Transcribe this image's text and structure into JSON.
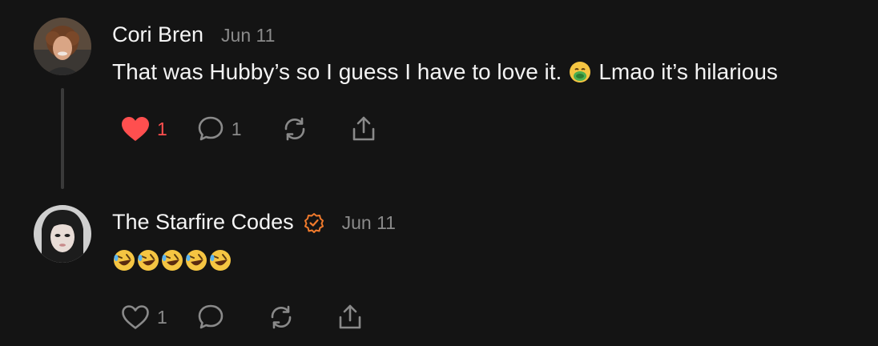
{
  "posts": [
    {
      "author": "Cori Bren",
      "date": "Jun 11",
      "text_before": "That was Hubby’s so I guess I have to love it.",
      "emoji": "nauseated-face",
      "text_after": "Lmao it’s hilarious",
      "like_count": "1",
      "liked": true,
      "reply_count": "1"
    },
    {
      "author": "The Starfire Codes",
      "date": "Jun 11",
      "verified": true,
      "emojis": [
        "rolling-on-floor-laughing",
        "rolling-on-floor-laughing",
        "rolling-on-floor-laughing",
        "rolling-on-floor-laughing",
        "rolling-on-floor-laughing"
      ],
      "like_count": "1",
      "liked": false,
      "reply_count": ""
    }
  ],
  "colors": {
    "background": "#141414",
    "muted": "#8a8a8a",
    "like": "#ff4f4f",
    "verified": "#f07a2c",
    "thread_line": "#3a3a3a"
  }
}
